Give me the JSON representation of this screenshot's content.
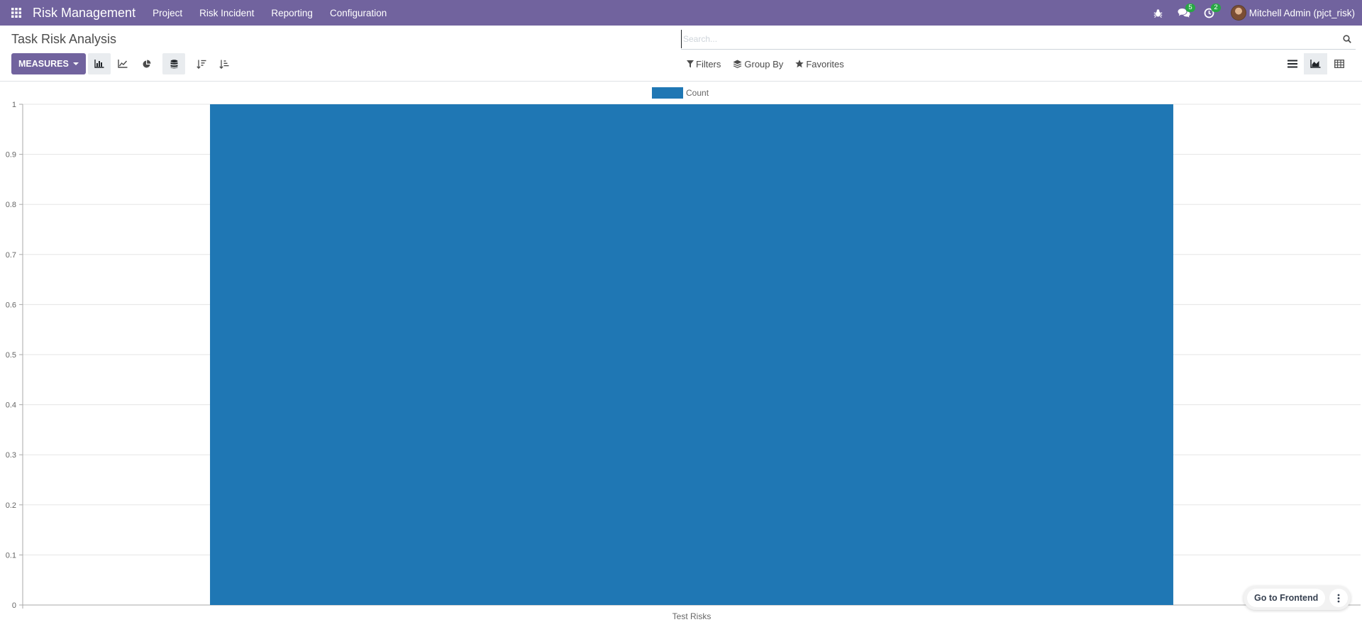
{
  "navbar": {
    "brand": "Risk Management",
    "menu": [
      "Project",
      "Risk Incident",
      "Reporting",
      "Configuration"
    ],
    "messages_badge": "5",
    "activities_badge": "2",
    "user_name": "Mitchell Admin (pjct_risk)",
    "background_color": "#71639e"
  },
  "control_panel": {
    "title": "Task Risk Analysis",
    "search_placeholder": "Search...",
    "measures_label": "MEASURES",
    "filters_label": "Filters",
    "group_by_label": "Group By",
    "favorites_label": "Favorites",
    "active_chart_type": "bar",
    "stacked_active": true,
    "active_view": "graph"
  },
  "floating": {
    "go_to_frontend_label": "Go to Frontend"
  },
  "chart_data": {
    "type": "bar",
    "categories": [
      "Test Risks"
    ],
    "series": [
      {
        "name": "Count",
        "values": [
          1
        ],
        "color": "#1f77b4"
      }
    ],
    "ylim": [
      0,
      1
    ],
    "yticks": [
      "0",
      "0.1",
      "0.2",
      "0.3",
      "0.4",
      "0.5",
      "0.6",
      "0.7",
      "0.8",
      "0.9",
      "1"
    ],
    "grid": true,
    "legend": "top-center"
  }
}
